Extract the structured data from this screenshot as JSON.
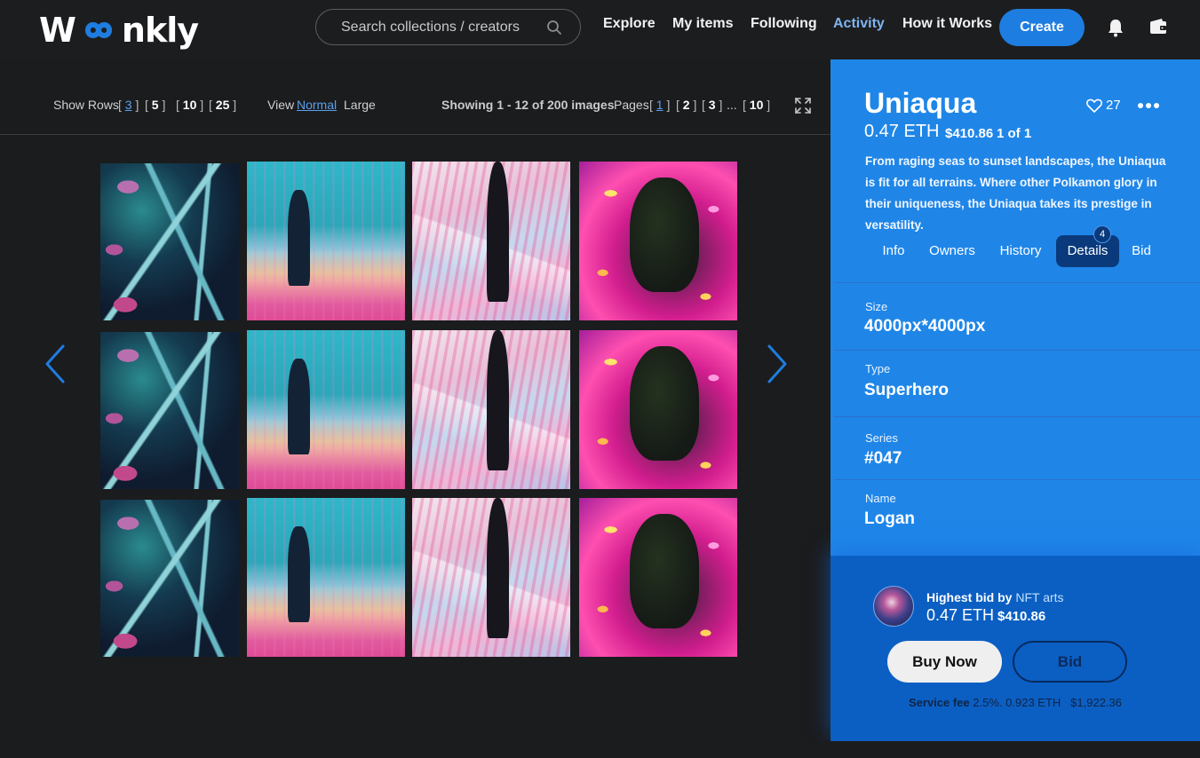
{
  "brand": {
    "logo_text_left": "W",
    "logo_text_right": "nkly"
  },
  "search": {
    "placeholder": "Search collections / creators"
  },
  "nav": {
    "items": [
      {
        "label": "Explore",
        "active": false
      },
      {
        "label": "My items",
        "active": false
      },
      {
        "label": "Following",
        "active": false
      },
      {
        "label": "Activity",
        "active": true
      },
      {
        "label": "How it Works",
        "active": false
      }
    ],
    "create_label": "Create",
    "icons": [
      "bell-icon",
      "wallet-icon"
    ]
  },
  "toolbar": {
    "show_rows_label": "Show Rows",
    "rows_options": [
      "3",
      "5",
      "10",
      "25"
    ],
    "rows_selected": "3",
    "view_label": "View",
    "view_options": [
      "Normal",
      "Large"
    ],
    "view_selected": "Normal",
    "showing_text": "Showing 1 - 12 of 200 images",
    "pages_label": "Pages",
    "pages": [
      "1",
      "2",
      "3",
      "10"
    ],
    "page_ellipsis": "...",
    "page_selected": "1"
  },
  "gallery": {
    "columns": 4,
    "rows": 3,
    "image_styles": [
      "img-a",
      "img-b",
      "img-c",
      "img-d"
    ]
  },
  "item": {
    "title": "Uniaqua",
    "likes": "27",
    "price_eth": "0.47 ETH",
    "price_usd": "$410.86",
    "edition": "1 of 1",
    "description": "From raging seas to sunset landscapes, the Uniaqua is fit for all terrains. Where other Polkamon glory in their uniqueness, the Uniaqua takes its prestige in versatility.",
    "tabs": [
      "Info",
      "Owners",
      "History",
      "Details",
      "Bid"
    ],
    "active_tab": "Details",
    "details_badge": "4",
    "details": [
      {
        "key": "Size",
        "value": "4000px*4000px"
      },
      {
        "key": "Type",
        "value": "Superhero"
      },
      {
        "key": "Series",
        "value": "#047"
      },
      {
        "key": "Name",
        "value": "Logan"
      }
    ]
  },
  "bid": {
    "label": "Highest bid by",
    "bidder": "NFT arts",
    "eth": "0.47 ETH",
    "usd": "$410.86",
    "buy_now_label": "Buy Now",
    "bid_label": "Bid",
    "fee_label": "Service fee",
    "fee_percent": "2.5%.",
    "fee_eth": "0.923 ETH",
    "fee_usd": "$1,922.36"
  },
  "colors": {
    "accent": "#1f86e8",
    "active_link": "#7fb4f0",
    "panel_dark": "#0b5fc3",
    "background": "#1b1c1e"
  }
}
